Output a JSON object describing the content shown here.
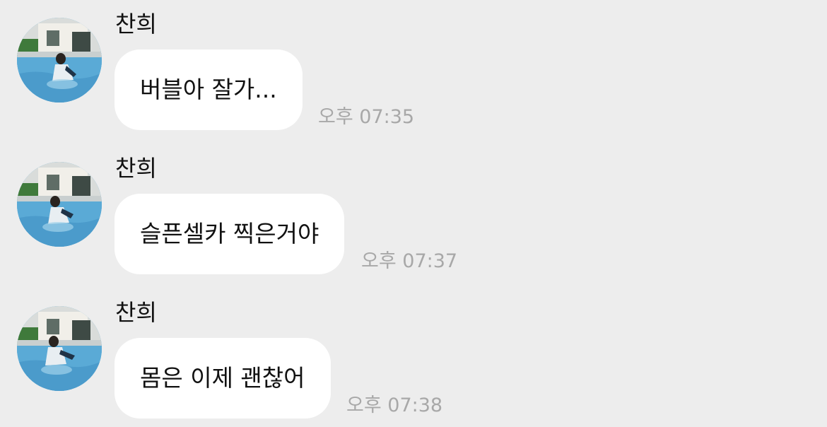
{
  "colors": {
    "background": "#ededed",
    "bubble": "#ffffff",
    "text": "#111111",
    "timestamp": "#a8a8a8"
  },
  "messages": [
    {
      "sender": "찬희",
      "avatar_icon": "profile-photo-avatar",
      "text": "버블아 잘가...",
      "time": "오후 07:35"
    },
    {
      "sender": "찬희",
      "avatar_icon": "profile-photo-avatar",
      "text": "슬픈셀카 찍은거야",
      "time": "오후 07:37"
    },
    {
      "sender": "찬희",
      "avatar_icon": "profile-photo-avatar",
      "text": "몸은 이제 괜찮어",
      "time": "오후 07:38"
    }
  ]
}
